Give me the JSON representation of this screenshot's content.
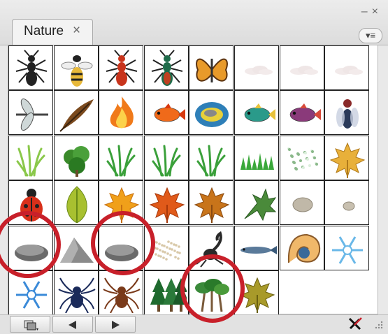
{
  "panel": {
    "tab_label": "Nature",
    "tab_close_glyph": "×",
    "minimize_glyph": "–",
    "close_glyph": "×",
    "menu_glyph": "▾≡"
  },
  "symbols": [
    "ant",
    "bee",
    "beetle-red",
    "beetle-green",
    "butterfly",
    "cloud",
    "cloud",
    "cloud",
    "dragonfly",
    "feather",
    "fire",
    "fish-orange",
    "fish-blue-round",
    "fish-green",
    "fish-purple",
    "fly",
    "grass-tall",
    "shrub",
    "grass",
    "grass",
    "grass",
    "grass-row",
    "flowers-dots",
    "leaf-maple-yellow",
    "ladybug",
    "leaf",
    "leaf-maple-orange",
    "leaf-maple-red",
    "leaf-maple-brown",
    "leaf-oak-green",
    "stone-light",
    "pebble",
    "rock-flat",
    "mountain-rock",
    "rock-flat",
    "sand-dots",
    "scorpion",
    "fish-long",
    "seashell",
    "snowflake",
    "snowflake-blue",
    "spider-blue",
    "spider-brown",
    "trees-pine",
    "trees-palm",
    "leaf-maple-olive"
  ],
  "highlights": [
    {
      "label": "rock-1"
    },
    {
      "label": "rock-2"
    },
    {
      "label": "trees"
    }
  ],
  "colors": {
    "highlight": "#c8202a"
  },
  "icons": {
    "library": "symbol-library-icon",
    "previous": "previous-arrow-icon",
    "next": "next-arrow-icon",
    "break_link": "break-link-icon",
    "grip": "resize-grip-icon"
  }
}
